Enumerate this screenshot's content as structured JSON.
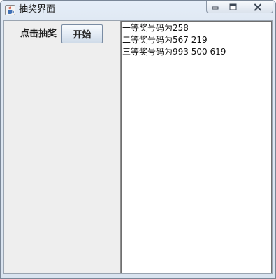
{
  "window": {
    "title": "抽奖界面",
    "icons": {
      "app": "java-cup-icon",
      "minimize": "minimize-icon",
      "maximize": "maximize-icon",
      "close": "close-icon"
    }
  },
  "left_panel": {
    "prompt_label": "点击抽奖",
    "start_button_label": "开始"
  },
  "results": {
    "lines": [
      "一等奖号码为258",
      "二等奖号码为567 219",
      "三等奖号码为993 500 619"
    ]
  },
  "colors": {
    "titlebar": "#dfe8f3",
    "panel_bg": "#eeeeee",
    "text_area_bg": "#ffffff",
    "button_border": "#7a8ca3"
  }
}
